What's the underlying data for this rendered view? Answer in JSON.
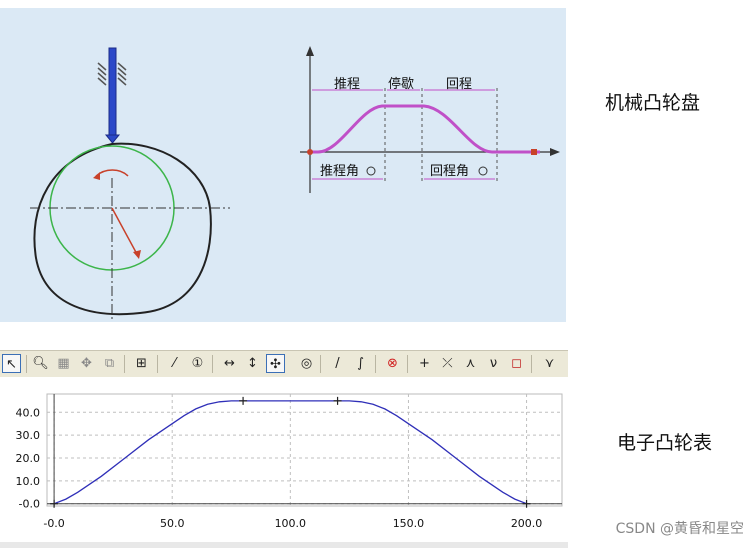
{
  "mechanical": {
    "title": "机械凸轮盘",
    "diagram": {
      "labels": {
        "rise": "推程",
        "dwell": "停歇",
        "return": "回程",
        "rise_angle": "推程角",
        "return_angle": "回程角"
      },
      "colors": {
        "profile": "#c050c8",
        "base_circle": "#3cb54a",
        "cam": "#222222",
        "follower": "#2b48c8"
      }
    }
  },
  "electronic": {
    "title": "电子凸轮表",
    "toolbar": {
      "icons": [
        "select-arrow-icon",
        "zoom-icon",
        "zoom-area-icon",
        "pan-icon",
        "fit-icon",
        "grid-icon",
        "slope-icon",
        "number-icon",
        "horizontal-move-icon",
        "vertical-move-icon",
        "move-icon",
        "snap-icon",
        "line-icon",
        "curve-icon",
        "delete-icon",
        "add-point-icon",
        "split-icon",
        "merge-icon",
        "valley-icon",
        "square-icon",
        "mirror-icon"
      ]
    }
  },
  "chart_data": {
    "type": "line",
    "x_ticks": [
      "-0.0",
      "50.0",
      "100.0",
      "150.0",
      "200.0"
    ],
    "y_ticks": [
      "-0.0",
      "10.0",
      "20.0",
      "30.0",
      "40.0"
    ],
    "xlim": [
      -3,
      215
    ],
    "ylim": [
      -1,
      48
    ],
    "grid": true,
    "series": [
      {
        "color": "#2f2fb8",
        "points": [
          [
            0,
            0
          ],
          [
            5,
            2
          ],
          [
            10,
            5
          ],
          [
            20,
            12
          ],
          [
            30,
            20
          ],
          [
            40,
            28
          ],
          [
            50,
            35
          ],
          [
            55,
            38.5
          ],
          [
            60,
            41.5
          ],
          [
            65,
            43.5
          ],
          [
            70,
            44.6
          ],
          [
            75,
            45
          ],
          [
            80,
            45
          ],
          [
            100,
            45
          ],
          [
            120,
            45
          ],
          [
            125,
            45
          ],
          [
            130,
            44.6
          ],
          [
            135,
            43.5
          ],
          [
            140,
            41.5
          ],
          [
            145,
            38.5
          ],
          [
            150,
            35
          ],
          [
            160,
            28
          ],
          [
            170,
            20
          ],
          [
            180,
            12
          ],
          [
            190,
            5
          ],
          [
            195,
            2
          ],
          [
            200,
            0
          ]
        ]
      }
    ],
    "markers": [
      [
        0,
        0
      ],
      [
        80,
        45
      ],
      [
        120,
        45
      ],
      [
        200,
        0
      ]
    ]
  },
  "watermark": "CSDN @黄昏和星空"
}
